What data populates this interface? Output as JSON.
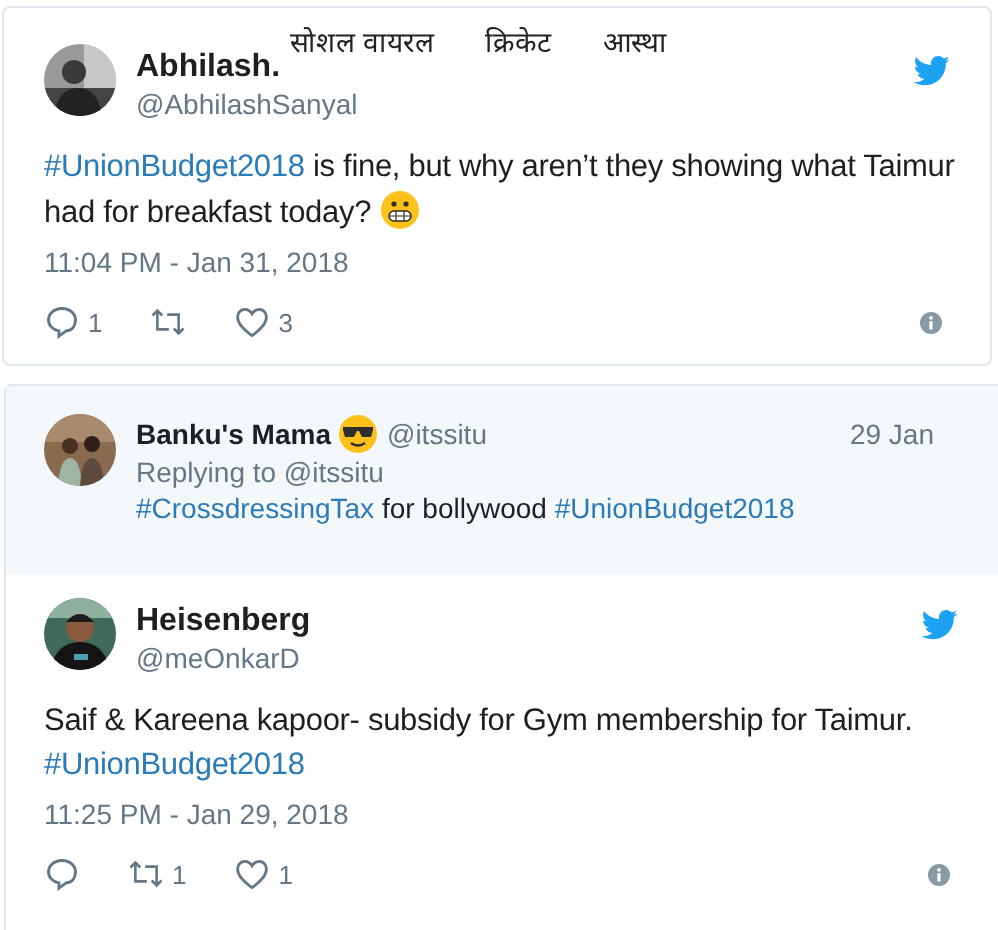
{
  "nav": [
    {
      "label": "सोशल वायरल"
    },
    {
      "label": "क्रिकेट"
    },
    {
      "label": "आस्था"
    }
  ],
  "tweet": {
    "name": "Abhilash.",
    "handle": "@AbhilashSanyal",
    "text": [
      {
        "kind": "hashtag",
        "text": "#UnionBudget2018"
      },
      {
        "kind": "plain",
        "text": " is fine, but why aren’t they showing what Taimur had for breakfast today? "
      },
      {
        "kind": "grimace"
      }
    ],
    "time": "11:04 PM - Jan 31, 2018",
    "actions": [
      {
        "kind": "reply",
        "count": "1"
      },
      {
        "kind": "retweet"
      },
      {
        "kind": "like",
        "count": "3"
      }
    ]
  },
  "thread": {
    "parent": {
      "name": "Banku's Mama",
      "badges": [
        {
          "kind": "sunglasses"
        }
      ],
      "handle": "@itssitu",
      "date": "29 Jan",
      "replying_to": "Replying to @itssitu",
      "text": [
        {
          "kind": "hashtag",
          "text": "#CrossdressingTax"
        },
        {
          "kind": "plain",
          "text": " for bollywood "
        },
        {
          "kind": "hashtag",
          "text": "#UnionBudget2018"
        }
      ]
    },
    "tweet": {
      "name": "Heisenberg",
      "handle": "@meOnkarD",
      "text": [
        {
          "kind": "plain",
          "text": "Saif & Kareena kapoor- subsidy for Gym membership for Taimur. "
        },
        {
          "kind": "hashtag",
          "text": "#UnionBudget2018"
        }
      ],
      "time": "11:25 PM - Jan 29, 2018",
      "actions": [
        {
          "kind": "reply"
        },
        {
          "kind": "retweet",
          "count": "1"
        },
        {
          "kind": "like",
          "count": "1"
        }
      ]
    }
  }
}
